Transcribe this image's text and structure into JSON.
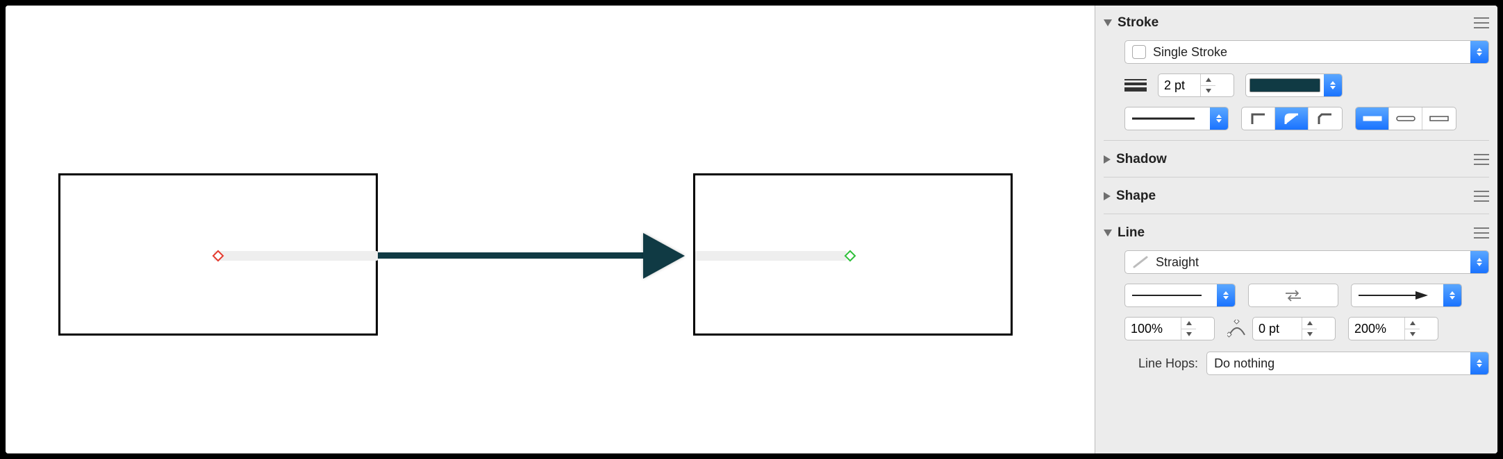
{
  "stroke": {
    "title": "Stroke",
    "type_label": "Single Stroke",
    "weight_value": "2 pt",
    "color": "#103a44"
  },
  "shadow": {
    "title": "Shadow"
  },
  "shape": {
    "title": "Shape"
  },
  "line": {
    "title": "Line",
    "style_label": "Straight",
    "start_scale": "100%",
    "midpoint_offset": "0 pt",
    "end_scale": "200%",
    "hops_label": "Line Hops:",
    "hops_value": "Do nothing"
  }
}
